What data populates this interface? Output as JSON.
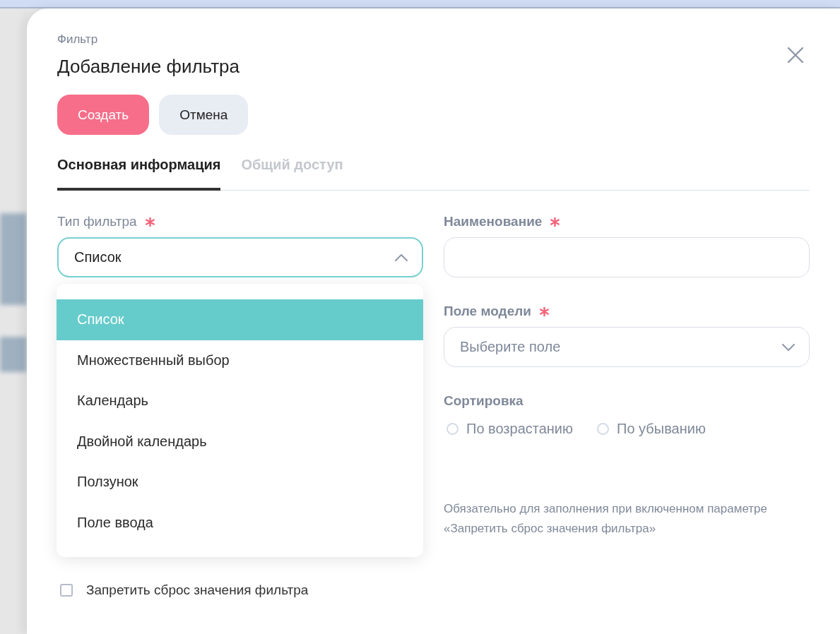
{
  "breadcrumb": "Фильтр",
  "title": "Добавление фильтра",
  "buttons": [
    {
      "label": "Создать",
      "kind": "primary"
    },
    {
      "label": "Отмена",
      "kind": "secondary"
    }
  ],
  "tabs": [
    {
      "label": "Основная информация",
      "selected": true
    },
    {
      "label": "Общий доступ",
      "selected": false
    }
  ],
  "filter_type": {
    "label": "Тип фильтра",
    "required": true,
    "value": "Список",
    "expanded": true,
    "options": [
      {
        "label": "Список",
        "selected": true
      },
      {
        "label": "Множественный выбор",
        "selected": false
      },
      {
        "label": "Календарь",
        "selected": false
      },
      {
        "label": "Двойной календарь",
        "selected": false
      },
      {
        "label": "Ползунок",
        "selected": false
      },
      {
        "label": "Поле ввода",
        "selected": false
      }
    ]
  },
  "name_field": {
    "label": "Наименование",
    "required": true
  },
  "model_field": {
    "label": "Поле модели",
    "required": true,
    "placeholder": "Выберите поле"
  },
  "sorting": {
    "label": "Сортировка",
    "options": [
      {
        "label": "По возрастанию",
        "selected": false
      },
      {
        "label": "По убыванию",
        "selected": false
      }
    ]
  },
  "hint": "Обязательно для заполнения при включенном параметре «Запретить сброс значения фильтра»",
  "reset_lock": {
    "label": "Запретить сброс значения фильтра",
    "checked": false
  }
}
